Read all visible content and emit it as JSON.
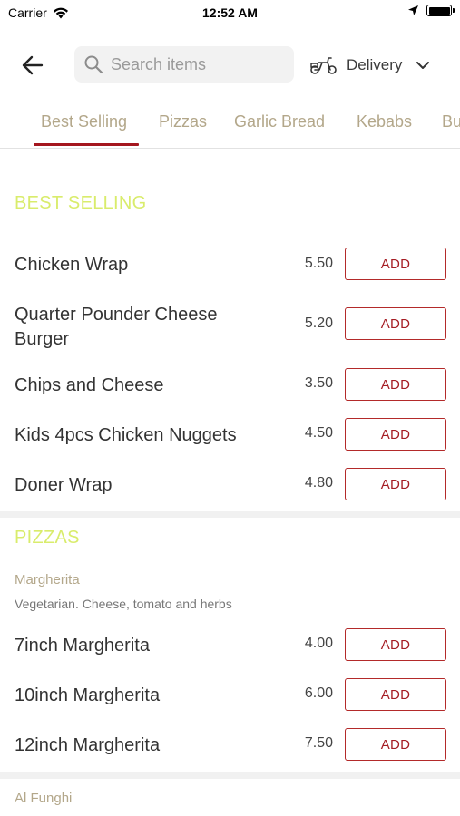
{
  "status_bar": {
    "carrier": "Carrier",
    "time": "12:52 AM"
  },
  "header": {
    "search_placeholder": "Search items",
    "delivery_label": "Delivery"
  },
  "tabs": [
    {
      "label": "Best Selling",
      "active": true
    },
    {
      "label": "Pizzas"
    },
    {
      "label": "Garlic Bread"
    },
    {
      "label": "Kebabs"
    },
    {
      "label": "Bu"
    }
  ],
  "add_label": "ADD",
  "sections": {
    "best_selling": {
      "title": "BEST SELLING",
      "items": [
        {
          "name": "Chicken Wrap",
          "price": "5.50"
        },
        {
          "name": "Quarter Pounder Cheese Burger",
          "price": "5.20"
        },
        {
          "name": "Chips and Cheese",
          "price": "3.50"
        },
        {
          "name": "Kids 4pcs Chicken Nuggets",
          "price": "4.50"
        },
        {
          "name": "Doner Wrap",
          "price": "4.80"
        }
      ]
    },
    "pizzas": {
      "title": "PIZZAS",
      "group": {
        "name": "Margherita",
        "description": "Vegetarian. Cheese, tomato and herbs"
      },
      "items": [
        {
          "name": "7inch Margherita",
          "price": "4.00"
        },
        {
          "name": "10inch Margherita",
          "price": "6.00"
        },
        {
          "name": "12inch Margherita",
          "price": "7.50"
        }
      ],
      "next_group": {
        "name": "Al Funghi"
      }
    }
  },
  "colors": {
    "accent": "#a51d24",
    "section_title": "#d9ec6c",
    "tab_text": "#b3a78a"
  }
}
